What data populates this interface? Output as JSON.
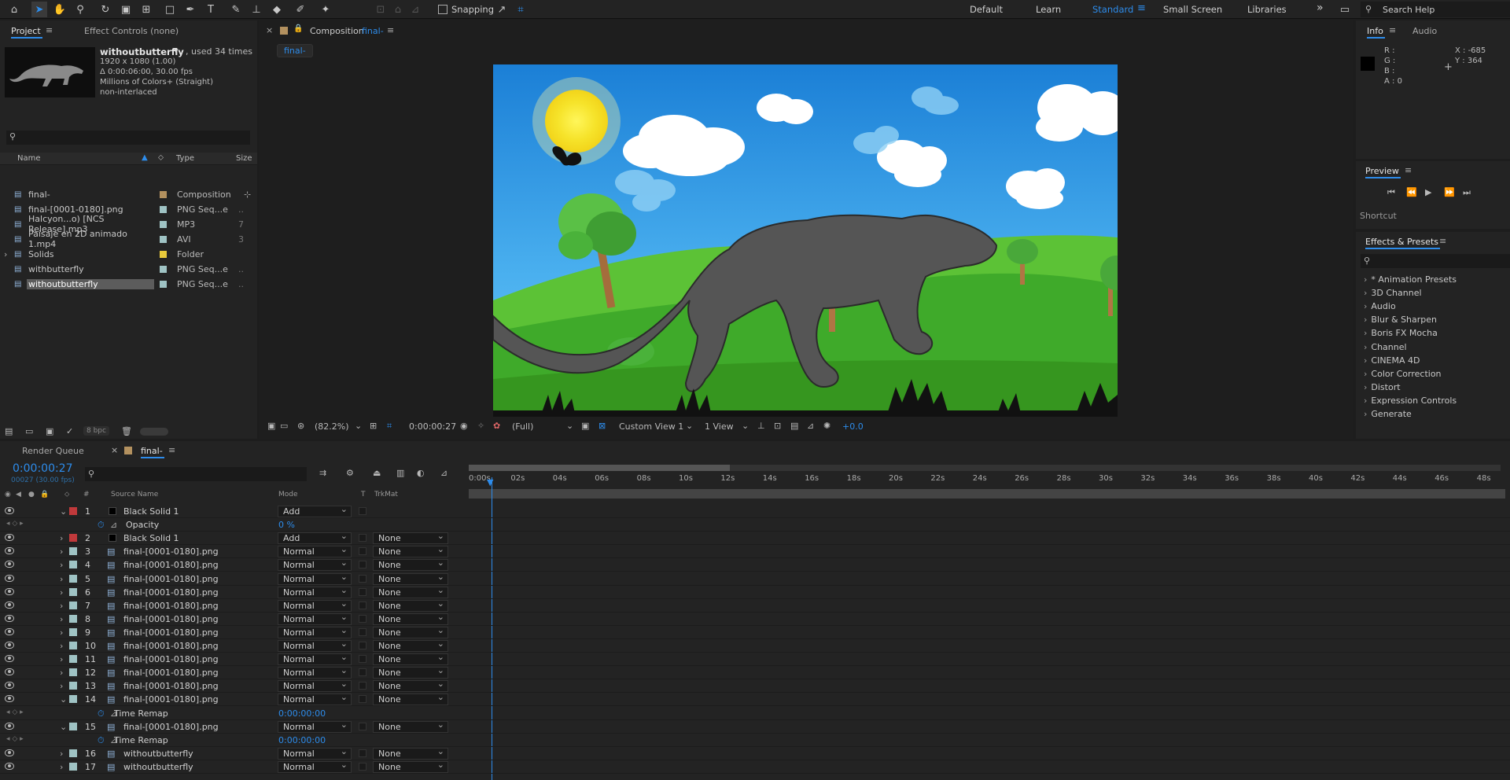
{
  "toolbar": {
    "tools": [
      "home-icon",
      "selection-icon",
      "hand-icon",
      "zoom-icon",
      "rotate-icon",
      "camera-icon",
      "pan-behind-icon",
      "rectangle-icon",
      "pen-icon",
      "type-icon",
      "brush-icon",
      "clone-stamp-icon",
      "eraser-icon",
      "roto-brush-icon",
      "puppet-pin-icon"
    ],
    "snapping_label": "Snapping",
    "workspaces": [
      "Default",
      "Learn",
      "Standard",
      "Small Screen",
      "Libraries"
    ],
    "active_workspace": "Standard",
    "search_placeholder": "Search Help"
  },
  "project_panel": {
    "tabs": [
      "Project",
      "Effect Controls (none)"
    ],
    "selected_item": {
      "name": "withoutbutterfly",
      "usage": ", used 34 times",
      "dims": "1920 x 1080 (1.00)",
      "duration": "Δ 0:00:06:00, 30.00 fps",
      "colors": "Millions of Colors+ (Straight)",
      "interlace": "non-interlaced"
    },
    "search_icon": "search-icon",
    "columns": [
      "Name",
      "Type",
      "Size"
    ],
    "items": [
      {
        "name": "final-",
        "type": "Composition",
        "color": "#b3915f",
        "icon": "composition-icon",
        "size": ""
      },
      {
        "name": "final-[0001-0180].png",
        "type": "PNG Seq...e",
        "color": "#9fc3c4",
        "icon": "footage-icon",
        "size": ".."
      },
      {
        "name": "Halcyon...o) [NCS Release].mp3",
        "type": "MP3",
        "color": "#9fc3c4",
        "icon": "audio-icon",
        "size": "7"
      },
      {
        "name": "Paisaje en 2D animado 1.mp4",
        "type": "AVI",
        "color": "#9fc3c4",
        "icon": "video-icon",
        "size": "3"
      },
      {
        "name": "Solids",
        "type": "Folder",
        "color": "#e8c93b",
        "icon": "folder-icon",
        "size": ""
      },
      {
        "name": "withbutterfly",
        "type": "PNG Seq...e",
        "color": "#9fc3c4",
        "icon": "footage-icon",
        "size": ".."
      },
      {
        "name": "withoutbutterfly",
        "type": "PNG Seq...e",
        "color": "#9fc3c4",
        "icon": "footage-icon",
        "size": ".."
      }
    ],
    "bpc": "8 bpc"
  },
  "comp_panel": {
    "tab_label": "Composition",
    "comp_name": "final-",
    "subtab": "final-",
    "zoom": "(82.2%)",
    "timecode": "0:00:00:27",
    "resolution": "(Full)",
    "view": "Custom View 1",
    "views": "1 View",
    "exposure": "+0.0"
  },
  "info_panel": {
    "tabs": [
      "Info",
      "Audio"
    ],
    "r": "R :",
    "g": "G :",
    "b": "B :",
    "a": "A :  0",
    "x": "X : -685",
    "y": "Y : 364"
  },
  "preview_panel": {
    "title": "Preview",
    "shortcut": "Shortcut"
  },
  "effects_panel": {
    "title": "Effects & Presets",
    "items": [
      "* Animation Presets",
      "3D Channel",
      "Audio",
      "Blur & Sharpen",
      "Boris FX Mocha",
      "Channel",
      "CINEMA 4D",
      "Color Correction",
      "Distort",
      "Expression Controls",
      "Generate"
    ]
  },
  "timeline": {
    "tabs": [
      "Render Queue",
      "final-"
    ],
    "timecode": "0:00:00:27",
    "frame_info": "00027 (30.00 fps)",
    "columns": [
      "Source Name",
      "Mode",
      "T",
      "TrkMat"
    ],
    "ruler": [
      "0:00s",
      "02s",
      "04s",
      "06s",
      "08s",
      "10s",
      "12s",
      "14s",
      "16s",
      "18s",
      "20s",
      "22s",
      "24s",
      "26s",
      "28s",
      "30s",
      "32s",
      "34s",
      "36s",
      "38s",
      "40s",
      "42s",
      "44s",
      "46s",
      "48s"
    ],
    "rows": [
      {
        "kind": "layer",
        "num": "1",
        "name": "Black Solid 1",
        "mode": "Add",
        "trk": "",
        "color": "#c0393b",
        "solid": true,
        "open": true
      },
      {
        "kind": "prop",
        "name": "Opacity",
        "value": "0 %"
      },
      {
        "kind": "layer",
        "num": "2",
        "name": "Black Solid 1",
        "mode": "Add",
        "trk": "None",
        "color": "#c0393b",
        "solid": true
      },
      {
        "kind": "layer",
        "num": "3",
        "name": "final-[0001-0180].png",
        "mode": "Normal",
        "trk": "None",
        "color": "#9fc3c4"
      },
      {
        "kind": "layer",
        "num": "4",
        "name": "final-[0001-0180].png",
        "mode": "Normal",
        "trk": "None",
        "color": "#9fc3c4"
      },
      {
        "kind": "layer",
        "num": "5",
        "name": "final-[0001-0180].png",
        "mode": "Normal",
        "trk": "None",
        "color": "#9fc3c4"
      },
      {
        "kind": "layer",
        "num": "6",
        "name": "final-[0001-0180].png",
        "mode": "Normal",
        "trk": "None",
        "color": "#9fc3c4"
      },
      {
        "kind": "layer",
        "num": "7",
        "name": "final-[0001-0180].png",
        "mode": "Normal",
        "trk": "None",
        "color": "#9fc3c4"
      },
      {
        "kind": "layer",
        "num": "8",
        "name": "final-[0001-0180].png",
        "mode": "Normal",
        "trk": "None",
        "color": "#9fc3c4"
      },
      {
        "kind": "layer",
        "num": "9",
        "name": "final-[0001-0180].png",
        "mode": "Normal",
        "trk": "None",
        "color": "#9fc3c4"
      },
      {
        "kind": "layer",
        "num": "10",
        "name": "final-[0001-0180].png",
        "mode": "Normal",
        "trk": "None",
        "color": "#9fc3c4"
      },
      {
        "kind": "layer",
        "num": "11",
        "name": "final-[0001-0180].png",
        "mode": "Normal",
        "trk": "None",
        "color": "#9fc3c4"
      },
      {
        "kind": "layer",
        "num": "12",
        "name": "final-[0001-0180].png",
        "mode": "Normal",
        "trk": "None",
        "color": "#9fc3c4"
      },
      {
        "kind": "layer",
        "num": "13",
        "name": "final-[0001-0180].png",
        "mode": "Normal",
        "trk": "None",
        "color": "#9fc3c4"
      },
      {
        "kind": "layer",
        "num": "14",
        "name": "final-[0001-0180].png",
        "mode": "Normal",
        "trk": "None",
        "color": "#9fc3c4",
        "open": true
      },
      {
        "kind": "prop",
        "name": "Time Remap",
        "value": "0:00:00:00"
      },
      {
        "kind": "layer",
        "num": "15",
        "name": "final-[0001-0180].png",
        "mode": "Normal",
        "trk": "None",
        "color": "#9fc3c4",
        "open": true
      },
      {
        "kind": "prop",
        "name": "Time Remap",
        "value": "0:00:00:00"
      },
      {
        "kind": "layer",
        "num": "16",
        "name": "withoutbutterfly",
        "mode": "Normal",
        "trk": "None",
        "color": "#9fc3c4"
      },
      {
        "kind": "layer",
        "num": "17",
        "name": "withoutbutterfly",
        "mode": "Normal",
        "trk": "None",
        "color": "#9fc3c4"
      }
    ]
  }
}
